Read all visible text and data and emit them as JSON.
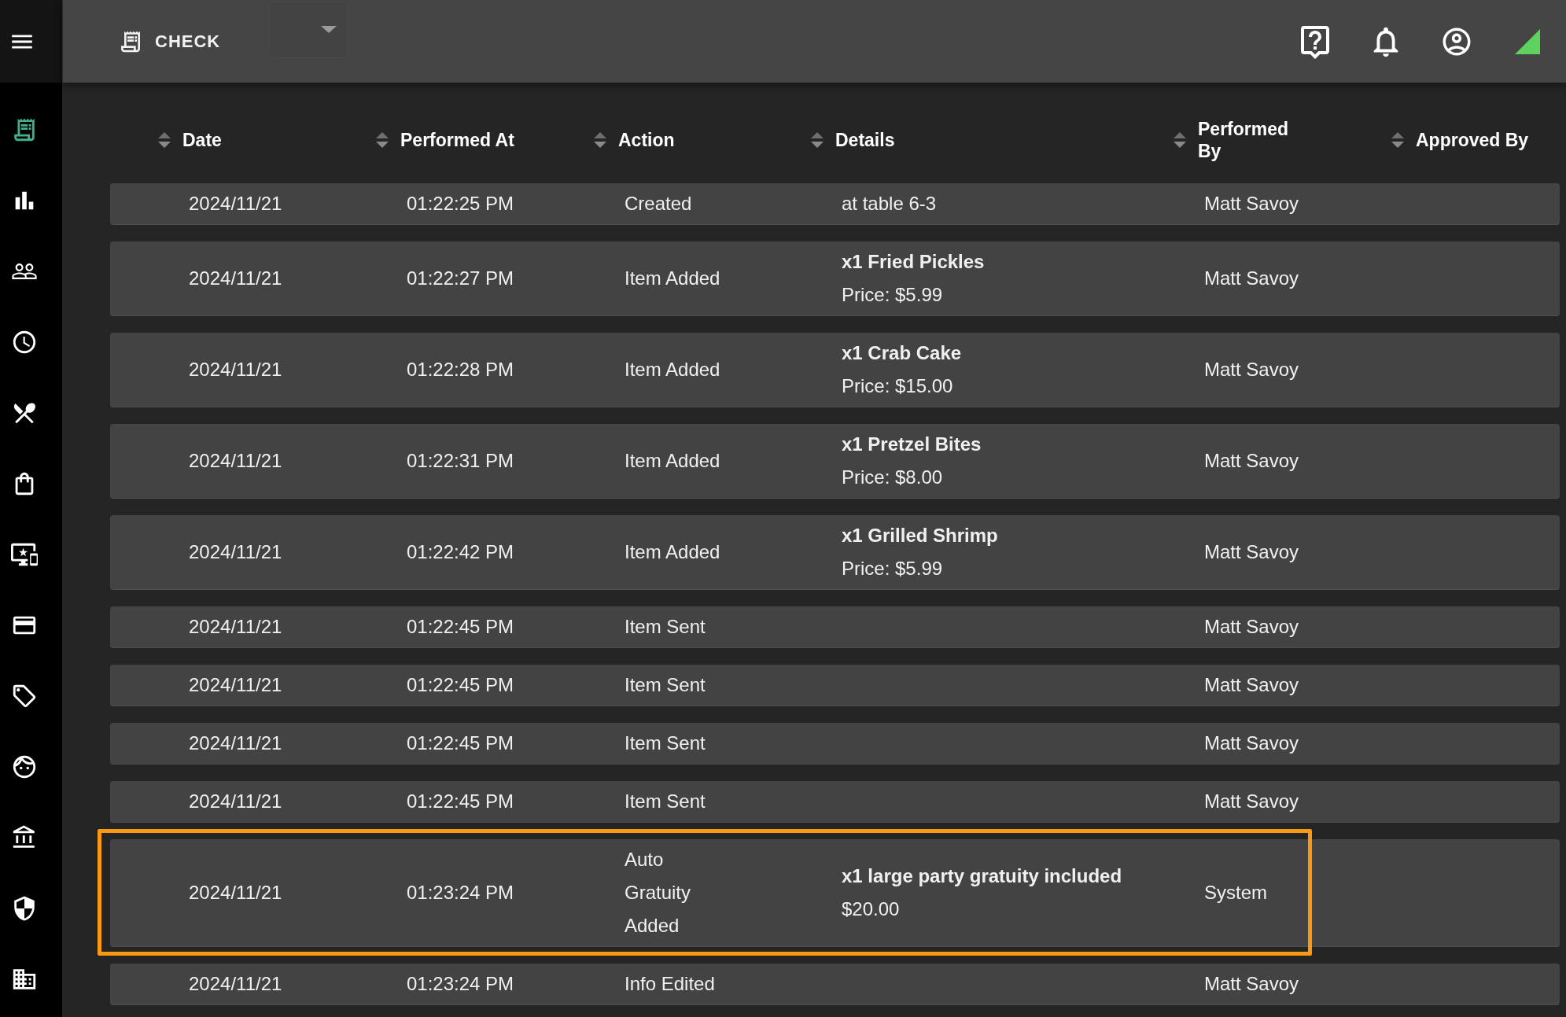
{
  "sidebar": {
    "items": [
      {
        "selected": true
      },
      {
        "selected": false
      },
      {
        "selected": false
      },
      {
        "selected": false
      },
      {
        "selected": false
      },
      {
        "selected": false
      },
      {
        "selected": false
      },
      {
        "selected": false
      },
      {
        "selected": false
      },
      {
        "selected": false
      },
      {
        "selected": false
      },
      {
        "selected": false
      },
      {
        "selected": false
      }
    ]
  },
  "top_bar": {
    "title": "CHECK",
    "dropdown": {
      "expanded": false
    }
  },
  "table": {
    "columns": [
      "Date",
      "Performed At",
      "Action",
      "Details",
      "Performed By",
      "Approved By"
    ],
    "rows": [
      {
        "date": "2024/11/21",
        "performed_at": "01:22:25 PM",
        "action": "Created",
        "details": {
          "text": "at table 6-3"
        },
        "performed_by": "Matt Savoy",
        "highlighted": false
      },
      {
        "date": "2024/11/21",
        "performed_at": "01:22:27 PM",
        "action": "Item Added",
        "details": {
          "heading": "x1 Fried Pickles",
          "text": "Price: $5.99"
        },
        "performed_by": "Matt Savoy",
        "highlighted": false
      },
      {
        "date": "2024/11/21",
        "performed_at": "01:22:28 PM",
        "action": "Item Added",
        "details": {
          "heading": "x1 Crab Cake",
          "text": "Price: $15.00"
        },
        "performed_by": "Matt Savoy",
        "highlighted": false
      },
      {
        "date": "2024/11/21",
        "performed_at": "01:22:31 PM",
        "action": "Item Added",
        "details": {
          "heading": "x1 Pretzel Bites",
          "text": "Price: $8.00"
        },
        "performed_by": "Matt Savoy",
        "highlighted": false
      },
      {
        "date": "2024/11/21",
        "performed_at": "01:22:42 PM",
        "action": "Item Added",
        "details": {
          "heading": "x1 Grilled Shrimp",
          "text": "Price: $5.99"
        },
        "performed_by": "Matt Savoy",
        "highlighted": false
      },
      {
        "date": "2024/11/21",
        "performed_at": "01:22:45 PM",
        "action": "Item Sent",
        "performed_by": "Matt Savoy",
        "highlighted": false
      },
      {
        "date": "2024/11/21",
        "performed_at": "01:22:45 PM",
        "action": "Item Sent",
        "performed_by": "Matt Savoy",
        "highlighted": false
      },
      {
        "date": "2024/11/21",
        "performed_at": "01:22:45 PM",
        "action": "Item Sent",
        "performed_by": "Matt Savoy",
        "highlighted": false
      },
      {
        "date": "2024/11/21",
        "performed_at": "01:22:45 PM",
        "action": "Item Sent",
        "performed_by": "Matt Savoy",
        "highlighted": false
      },
      {
        "date": "2024/11/21",
        "performed_at": "01:23:24 PM",
        "action": "Auto Gratuity Added",
        "details": {
          "heading": "x1 large party gratuity included",
          "text": "$20.00"
        },
        "performed_by": "System",
        "highlighted": true
      },
      {
        "date": "2024/11/21",
        "performed_at": "01:23:24 PM",
        "action": "Info Edited",
        "performed_by": "Matt Savoy",
        "highlighted": false
      }
    ]
  }
}
